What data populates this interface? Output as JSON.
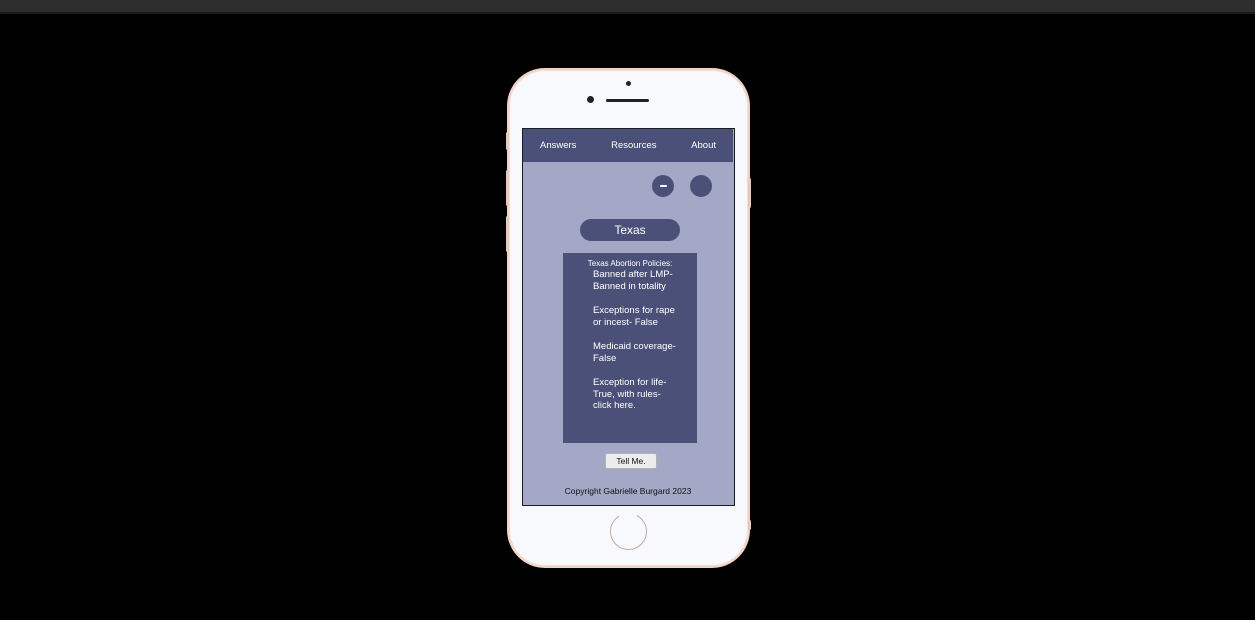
{
  "nav": {
    "items": [
      {
        "label": "Answers"
      },
      {
        "label": "Resources"
      },
      {
        "label": "About"
      }
    ]
  },
  "state": {
    "name": "Texas"
  },
  "policies": {
    "title": "Texas Abortion Policies:",
    "items": [
      "Banned after LMP- Banned in totality",
      "Exceptions for rape or incest- False",
      "Medicaid coverage- False",
      "Exception for life- True, with rules- click here."
    ]
  },
  "actions": {
    "tell_me_label": "Tell Me."
  },
  "footer": {
    "copyright": "Copyright Gabrielle Burgard 2023"
  },
  "colors": {
    "accent": "#4b5078",
    "screen_bg": "#a2a8c6",
    "phone_body": "#f8f9fc",
    "phone_trim": "#f1d3c7"
  },
  "icons": {
    "zoom_out": "minus-icon",
    "second_control": "circle-icon"
  }
}
